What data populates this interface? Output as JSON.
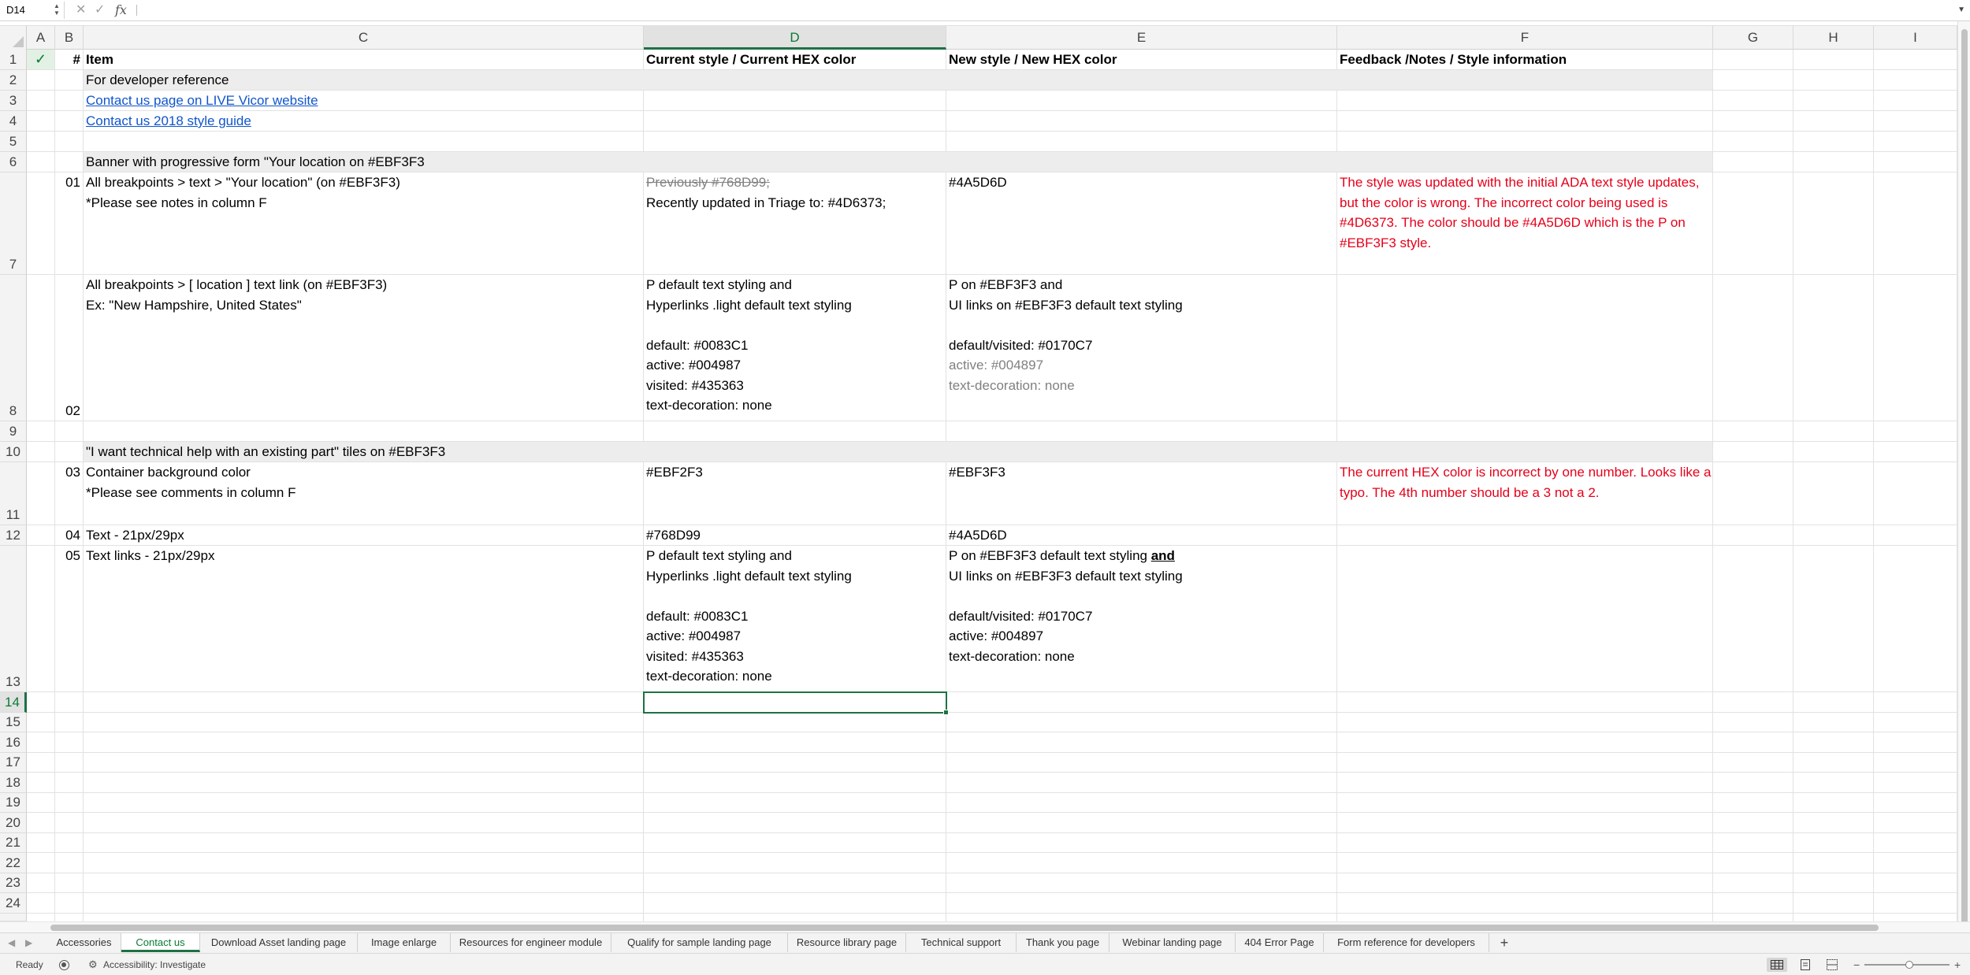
{
  "formula_bar": {
    "name_box": "D14",
    "cancel_glyph": "✕",
    "confirm_glyph": "✓",
    "fx_label": "fx",
    "formula": ""
  },
  "columns": [
    "A",
    "B",
    "C",
    "D",
    "E",
    "F",
    "G",
    "H",
    "I"
  ],
  "selected_column": "D",
  "rows": [
    "1",
    "2",
    "3",
    "4",
    "5",
    "6",
    "7",
    "8",
    "9",
    "10",
    "11",
    "12",
    "13",
    "14",
    "15",
    "16",
    "17",
    "18",
    "19",
    "20",
    "21",
    "22",
    "23",
    "24"
  ],
  "selected_row": "14",
  "cells": {
    "A1": "✓",
    "B1": "#",
    "C1": "Item",
    "D1": "Current style / Current HEX color",
    "E1": "New style / New HEX color",
    "F1": "Feedback /Notes / Style information",
    "C2": "For developer reference",
    "C3": "Contact us page on LIVE Vicor website",
    "C4": "Contact us 2018 style guide",
    "C6": "Banner with progressive form \"Your location on #EBF3F3",
    "B7": "01",
    "C7_line1": "All breakpoints > text > \"Your location\" (on #EBF3F3)",
    "C7_line2": "*Please see notes in column F",
    "D7_line1": "Previously #768D99;",
    "D7_line2": "Recently updated in Triage to: #4D6373;",
    "E7": "#4A5D6D",
    "F7": "The style was updated with the initial ADA text style updates,\nbut the color is wrong. The incorrect color being used is\n#4D6373. The color should be #4A5D6D which is the P on\n#EBF3F3 style.",
    "B8": "02",
    "C8": "All breakpoints > [ location ] text link (on #EBF3F3)\nEx: \"New Hampshire, United States\"",
    "D8": "P default text styling and\nHyperlinks .light default text styling\n\ndefault: #0083C1\nactive: #004987\nvisited: #435363\ntext-decoration: none",
    "E8_line1": "P on #EBF3F3 and",
    "E8_line2": "UI links on #EBF3F3 default text styling",
    "E8_line3": "default/visited: #0170C7",
    "E8_line4": "active: #004897",
    "E8_line5": "text-decoration: none",
    "C10": "\"I want technical help with an existing part\" tiles on #EBF3F3",
    "B11": "03",
    "C11_line1": "Container background color",
    "C11_line2": "*Please see comments in column F",
    "D11": "#EBF2F3",
    "E11": "#EBF3F3",
    "F11": "The current HEX color is incorrect by one number. Looks like a\ntypo. The 4th number should be a 3 not a 2.",
    "B12": "04",
    "C12": "Text - 21px/29px",
    "D12": "#768D99",
    "E12": "#4A5D6D",
    "B13": "05",
    "C13": "Text links - 21px/29px",
    "D13": "P default text styling and\nHyperlinks .light default text styling\n\ndefault: #0083C1\nactive: #004987\nvisited: #435363\ntext-decoration: none",
    "E13_line1a": "P on #EBF3F3 default text styling ",
    "E13_line1b": "and",
    "E13_line2": "UI links on #EBF3F3 default text styling",
    "E13_rest": "default/visited: #0170C7\nactive: #004897\ntext-decoration: none"
  },
  "sheet_tabs": [
    "Accessories",
    "Contact us",
    "Download Asset landing page",
    "Image enlarge",
    "Resources for engineer module",
    "Qualify for sample landing page",
    "Resource library page",
    "Technical support",
    "Thank you page",
    "Webinar landing page",
    "404 Error Page",
    "Form reference for developers"
  ],
  "active_tab": "Contact us",
  "add_tab_glyph": "+",
  "status": {
    "ready": "Ready",
    "accessibility": "Accessibility: Investigate",
    "zoom_minus": "−",
    "zoom_plus": "+"
  },
  "colors": {
    "accent_green": "#1e7145",
    "link_blue": "#1155cc",
    "feedback_red": "#e6001a",
    "section_gray": "#ededed"
  }
}
